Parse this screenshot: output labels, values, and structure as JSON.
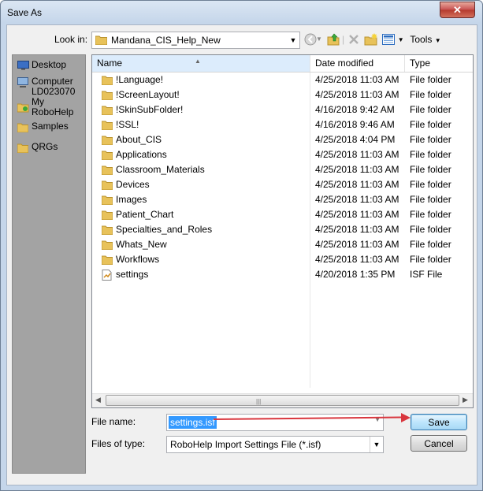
{
  "window": {
    "title": "Save As",
    "close_glyph": "✕"
  },
  "toolbar": {
    "look_in_label": "Look in:",
    "look_in_value": "Mandana_CIS_Help_New",
    "back_icon": "back-arrow-icon",
    "up_icon": "up-folder-icon",
    "delete_icon": "delete-icon",
    "new_folder_icon": "new-folder-icon",
    "views_icon": "views-menu-icon",
    "tools_label": "Tools"
  },
  "places": [
    {
      "label": "Desktop",
      "icon": "desktop-icon"
    },
    {
      "label": "Computer LD023070",
      "icon": "computer-icon"
    },
    {
      "label": "My RoboHelp",
      "icon": "robohelp-icon"
    },
    {
      "label": "Samples",
      "icon": "folder-icon"
    },
    {
      "label": "QRGs",
      "icon": "folder-icon"
    }
  ],
  "columns": {
    "name": "Name",
    "date": "Date modified",
    "type": "Type"
  },
  "files": [
    {
      "name": "!Language!",
      "date": "4/25/2018 11:03 AM",
      "type": "File folder",
      "icon": "folder-icon"
    },
    {
      "name": "!ScreenLayout!",
      "date": "4/25/2018 11:03 AM",
      "type": "File folder",
      "icon": "folder-icon"
    },
    {
      "name": "!SkinSubFolder!",
      "date": "4/16/2018 9:42 AM",
      "type": "File folder",
      "icon": "folder-icon"
    },
    {
      "name": "!SSL!",
      "date": "4/16/2018 9:46 AM",
      "type": "File folder",
      "icon": "folder-icon"
    },
    {
      "name": "About_CIS",
      "date": "4/25/2018 4:04 PM",
      "type": "File folder",
      "icon": "folder-icon"
    },
    {
      "name": "Applications",
      "date": "4/25/2018 11:03 AM",
      "type": "File folder",
      "icon": "folder-icon"
    },
    {
      "name": "Classroom_Materials",
      "date": "4/25/2018 11:03 AM",
      "type": "File folder",
      "icon": "folder-icon"
    },
    {
      "name": "Devices",
      "date": "4/25/2018 11:03 AM",
      "type": "File folder",
      "icon": "folder-icon"
    },
    {
      "name": "Images",
      "date": "4/25/2018 11:03 AM",
      "type": "File folder",
      "icon": "folder-icon"
    },
    {
      "name": "Patient_Chart",
      "date": "4/25/2018 11:03 AM",
      "type": "File folder",
      "icon": "folder-icon"
    },
    {
      "name": "Specialties_and_Roles",
      "date": "4/25/2018 11:03 AM",
      "type": "File folder",
      "icon": "folder-icon"
    },
    {
      "name": "Whats_New",
      "date": "4/25/2018 11:03 AM",
      "type": "File folder",
      "icon": "folder-icon"
    },
    {
      "name": "Workflows",
      "date": "4/25/2018 11:03 AM",
      "type": "File folder",
      "icon": "folder-icon"
    },
    {
      "name": "settings",
      "date": "4/20/2018 1:35 PM",
      "type": "ISF File",
      "icon": "isf-file-icon"
    }
  ],
  "form": {
    "file_name_label": "File name:",
    "file_name_value": "settings.isf",
    "file_type_label": "Files of type:",
    "file_type_value": "RoboHelp Import Settings File (*.isf)",
    "save_label": "Save",
    "cancel_label": "Cancel"
  },
  "colors": {
    "folder": "#e8c25a",
    "annotation_arrow": "#d9363e",
    "selection": "#3399ff"
  }
}
